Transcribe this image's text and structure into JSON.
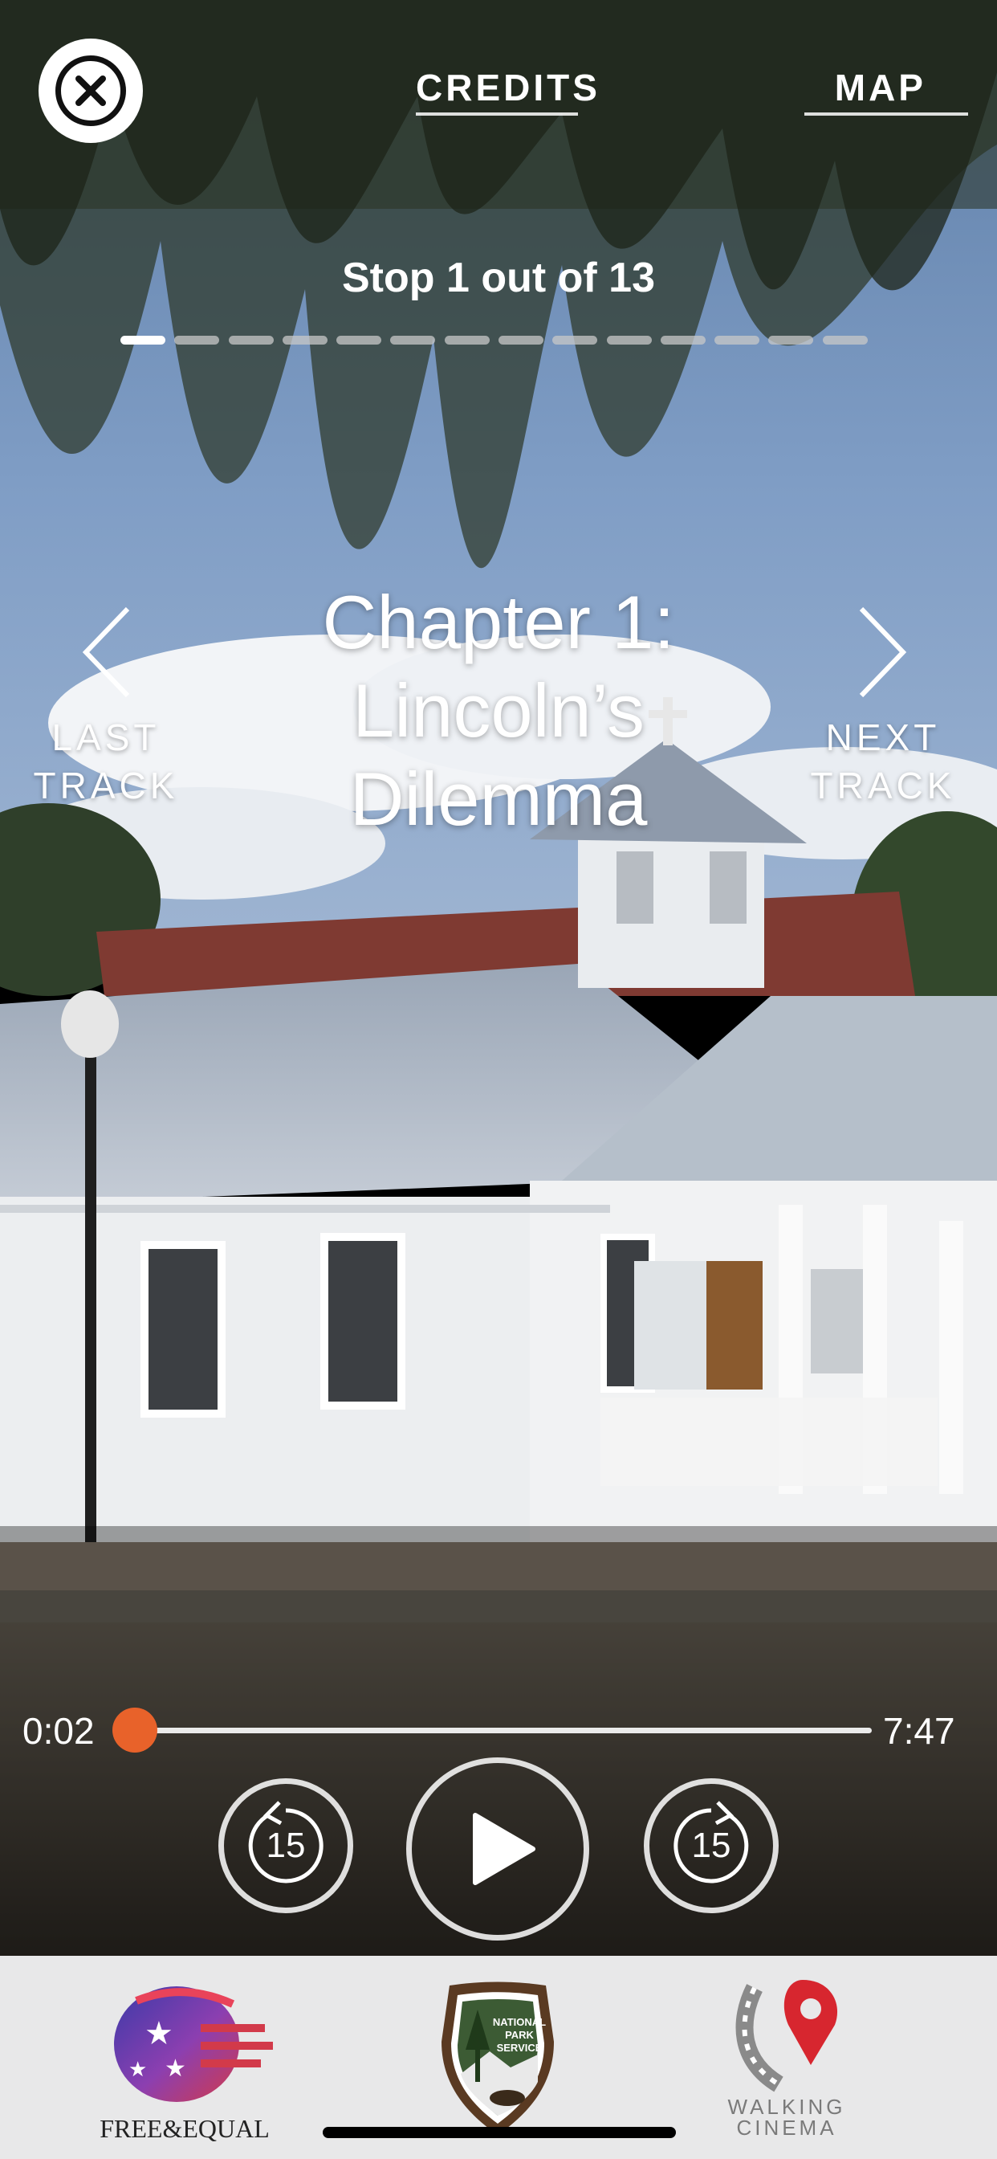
{
  "header": {
    "close_icon": "close-icon",
    "credits_label": "CREDITS",
    "map_label": "MAP"
  },
  "progress": {
    "stop_text": "Stop 1 out of 13",
    "current_stop": 1,
    "total_stops": 14
  },
  "chapter": {
    "title_line1": "Chapter 1:",
    "title_line2": "Lincoln’s",
    "title_line3": "Dilemma"
  },
  "navigation": {
    "last_line1": "LAST",
    "last_line2": "TRACK",
    "next_line1": "NEXT",
    "next_line2": "TRACK"
  },
  "player": {
    "current_time": "0:02",
    "total_time": "7:47",
    "progress_fraction": 0.004,
    "skip_back_seconds": "15",
    "skip_forward_seconds": "15",
    "accent_color": "#e8622a"
  },
  "footer": {
    "free_equal_text": "FREE&EQUAL",
    "nps_text_1": "NATIONAL",
    "nps_text_2": "PARK",
    "nps_text_3": "SERVICE",
    "walking_text_1": "WALKING",
    "walking_text_2": "CINEMA"
  }
}
